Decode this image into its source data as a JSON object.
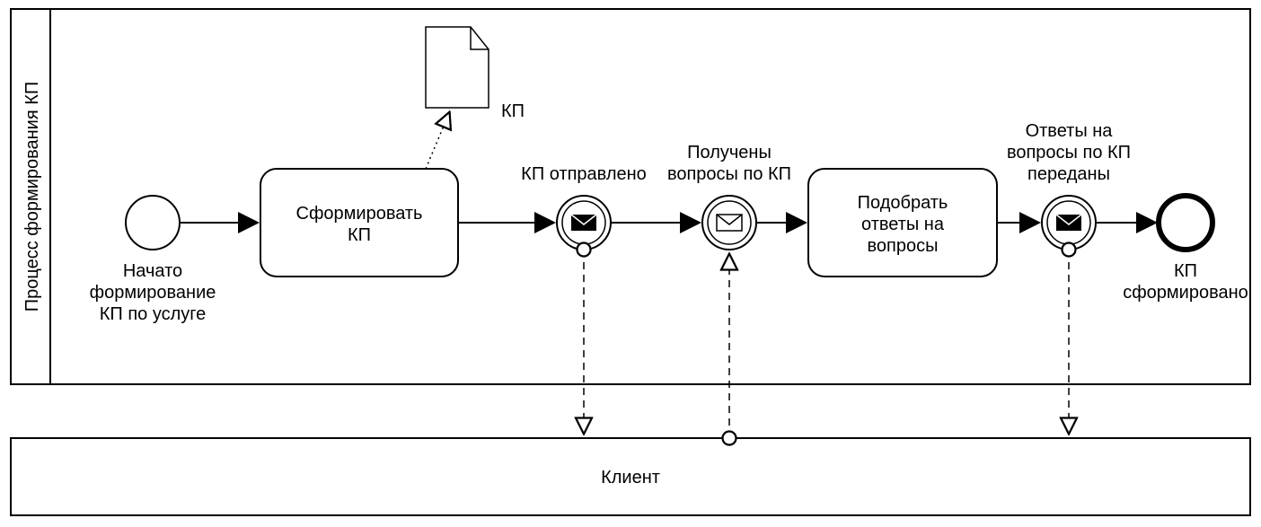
{
  "pool": {
    "title": "Процесс формирования КП"
  },
  "participant": {
    "title": "Клиент"
  },
  "start": {
    "label_l1": "Начато",
    "label_l2": "формирование",
    "label_l3": "КП по услуге"
  },
  "task1": {
    "label_l1": "Сформировать",
    "label_l2": "КП"
  },
  "artifact": {
    "label": "КП"
  },
  "msg_throw1": {
    "label": "КП отправлено"
  },
  "msg_catch": {
    "label_l1": "Получены",
    "label_l2": "вопросы по КП"
  },
  "task2": {
    "label_l1": "Подобрать",
    "label_l2": "ответы на",
    "label_l3": "вопросы"
  },
  "msg_throw2": {
    "label_l1": "Ответы на",
    "label_l2": "вопросы по КП",
    "label_l3": "переданы"
  },
  "end": {
    "label_l1": "КП",
    "label_l2": "сформировано"
  }
}
